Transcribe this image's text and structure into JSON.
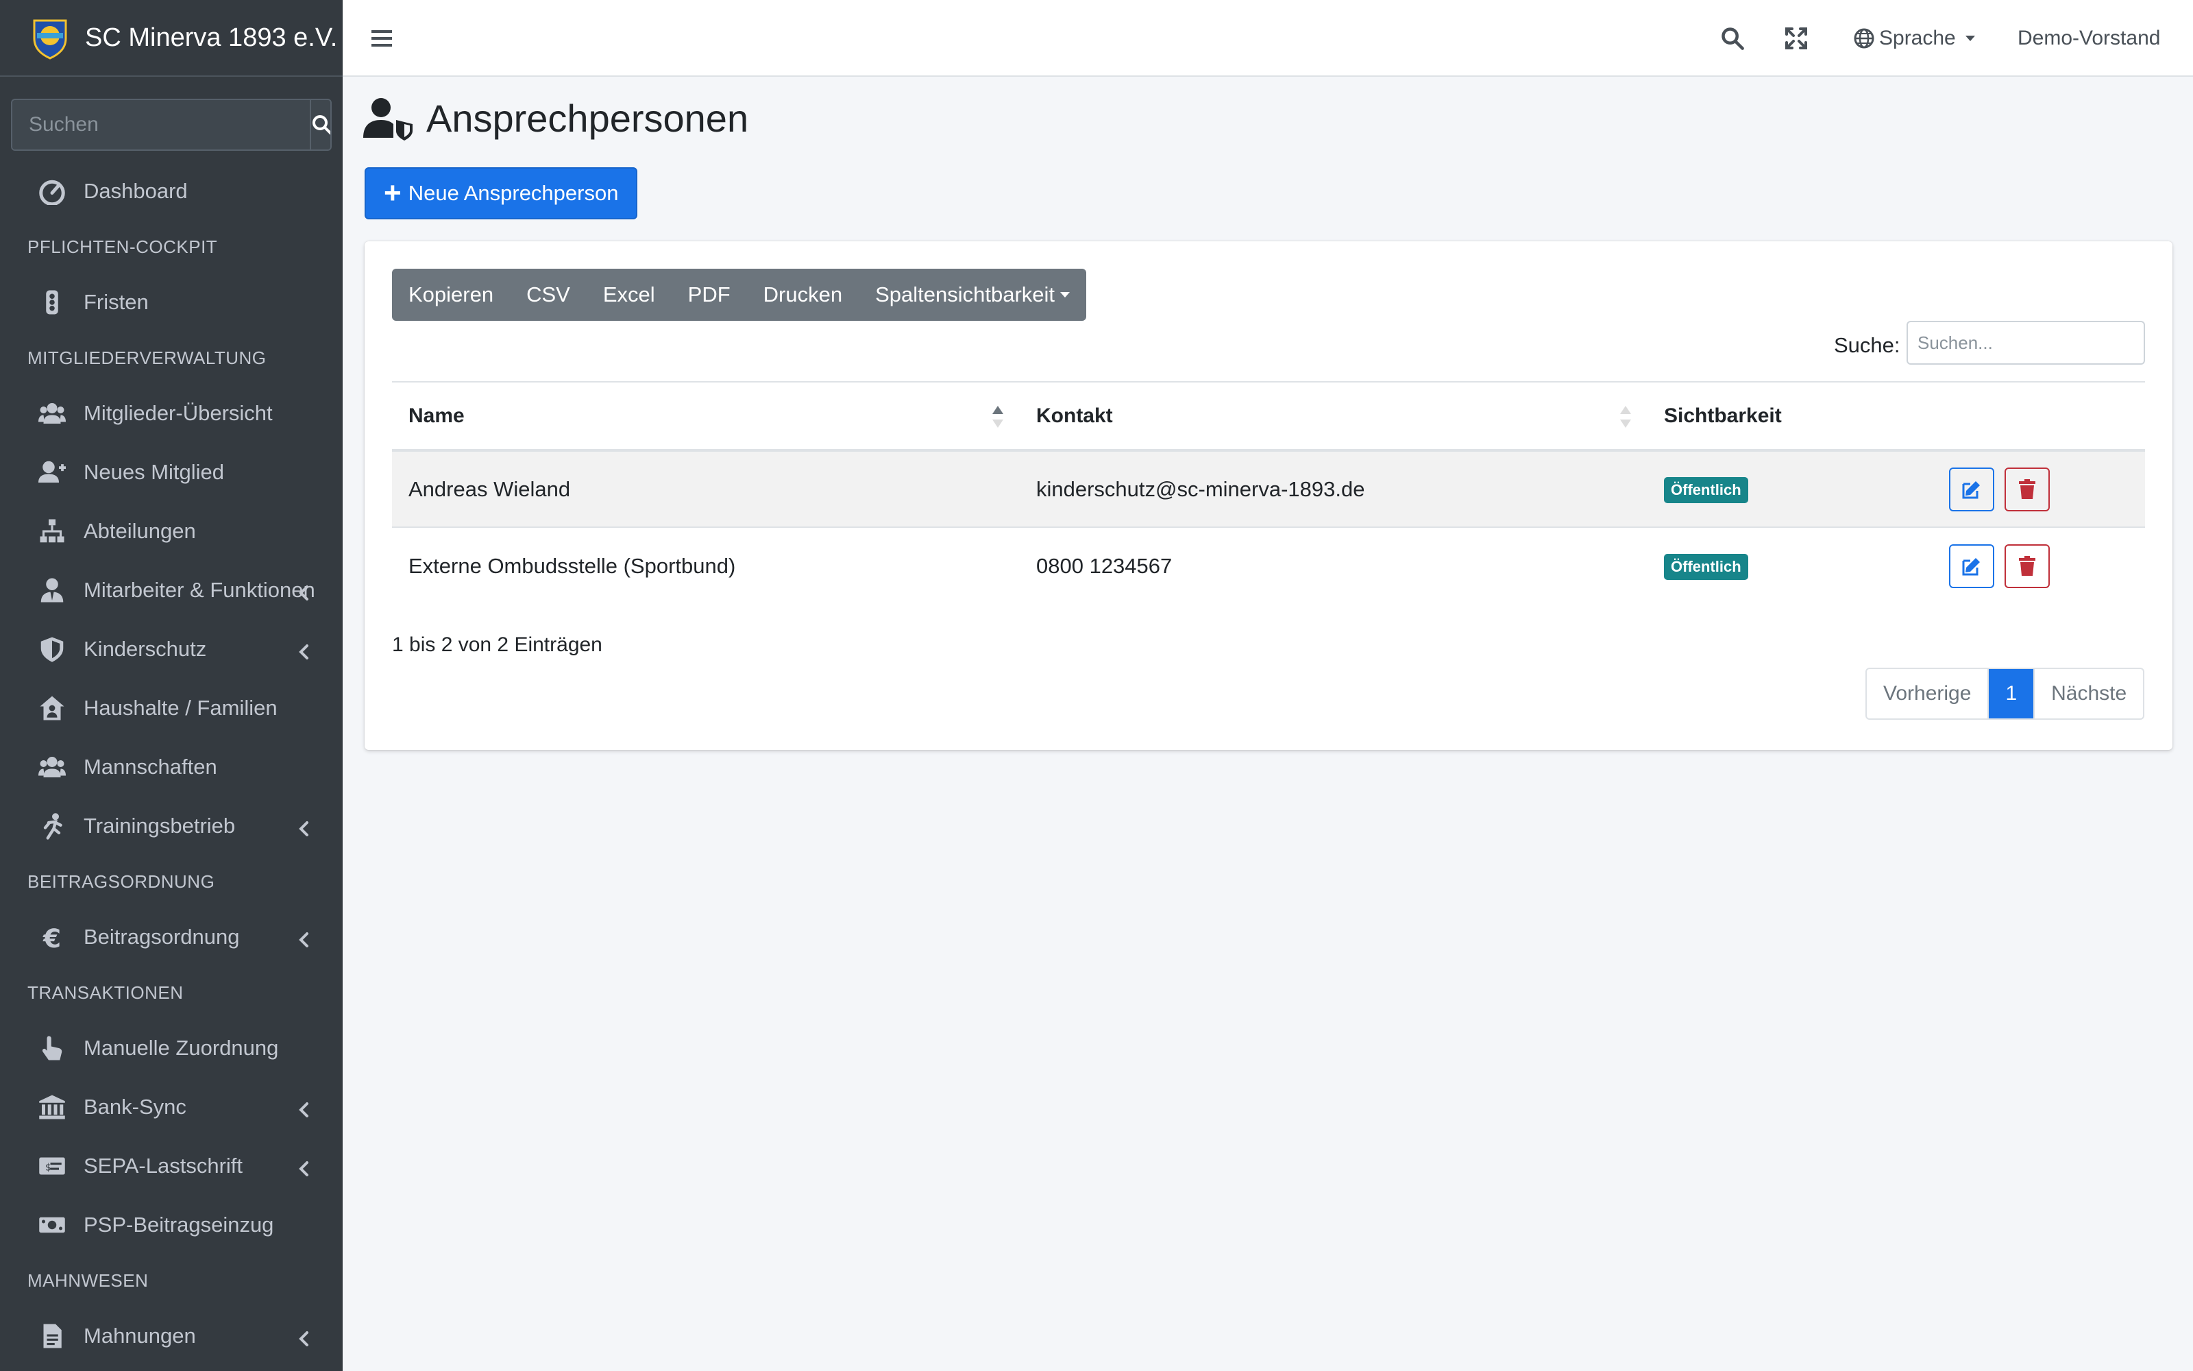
{
  "brand": {
    "name": "SC Minerva 1893 e.V."
  },
  "sidebar": {
    "search_placeholder": "Suchen",
    "items": [
      {
        "type": "item",
        "label": "Dashboard",
        "icon": "gauge-icon"
      },
      {
        "type": "header",
        "label": "PFLICHTEN-COCKPIT"
      },
      {
        "type": "item",
        "label": "Fristen",
        "icon": "traffic-light-icon"
      },
      {
        "type": "header",
        "label": "MITGLIEDERVERWALTUNG"
      },
      {
        "type": "item",
        "label": "Mitglieder-Übersicht",
        "icon": "users-icon"
      },
      {
        "type": "item",
        "label": "Neues Mitglied",
        "icon": "user-plus-icon"
      },
      {
        "type": "item",
        "label": "Abteilungen",
        "icon": "sitemap-icon"
      },
      {
        "type": "item",
        "label": "Mitarbeiter & Funktionen",
        "icon": "user-tie-icon",
        "chevron": true
      },
      {
        "type": "item",
        "label": "Kinderschutz",
        "icon": "shield-icon",
        "chevron": true
      },
      {
        "type": "item",
        "label": "Haushalte / Familien",
        "icon": "house-user-icon"
      },
      {
        "type": "item",
        "label": "Mannschaften",
        "icon": "team-icon"
      },
      {
        "type": "item",
        "label": "Trainingsbetrieb",
        "icon": "running-icon",
        "chevron": true
      },
      {
        "type": "header",
        "label": "BEITRAGSORDNUNG"
      },
      {
        "type": "item",
        "label": "Beitragsordnung",
        "icon": "euro-icon",
        "chevron": true
      },
      {
        "type": "header",
        "label": "TRANSAKTIONEN"
      },
      {
        "type": "item",
        "label": "Manuelle Zuordnung",
        "icon": "hand-pointer-icon"
      },
      {
        "type": "item",
        "label": "Bank-Sync",
        "icon": "bank-icon",
        "chevron": true
      },
      {
        "type": "item",
        "label": "SEPA-Lastschrift",
        "icon": "money-check-icon",
        "chevron": true
      },
      {
        "type": "item",
        "label": "PSP-Beitragseinzug",
        "icon": "money-bill-icon"
      },
      {
        "type": "header",
        "label": "MAHNWESEN"
      },
      {
        "type": "item",
        "label": "Mahnungen",
        "icon": "file-icon",
        "chevron": true
      }
    ]
  },
  "topbar": {
    "language": "Sprache",
    "user": "Demo-Vorstand"
  },
  "page": {
    "title": "Ansprechpersonen",
    "new_button": "Neue Ansprechperson"
  },
  "table_tools": {
    "buttons": [
      "Kopieren",
      "CSV",
      "Excel",
      "PDF",
      "Drucken"
    ],
    "column_visibility": "Spaltensichtbarkeit",
    "search_label": "Suche:",
    "search_placeholder": "Suchen..."
  },
  "table": {
    "columns": [
      "Name",
      "Kontakt",
      "Sichtbarkeit"
    ],
    "rows": [
      {
        "name": "Andreas Wieland",
        "contact": "kinderschutz@sc-minerva-1893.de",
        "visibility": "Öffentlich"
      },
      {
        "name": "Externe Ombudsstelle (Sportbund)",
        "contact": "0800 1234567",
        "visibility": "Öffentlich"
      }
    ]
  },
  "footer": {
    "info": "1 bis 2 von 2 Einträgen",
    "prev": "Vorherige",
    "page": "1",
    "next": "Nächste"
  },
  "colors": {
    "sidebar_bg": "#343a40",
    "primary": "#1a73e8",
    "badge": "#17858a",
    "danger": "#c0303a"
  }
}
